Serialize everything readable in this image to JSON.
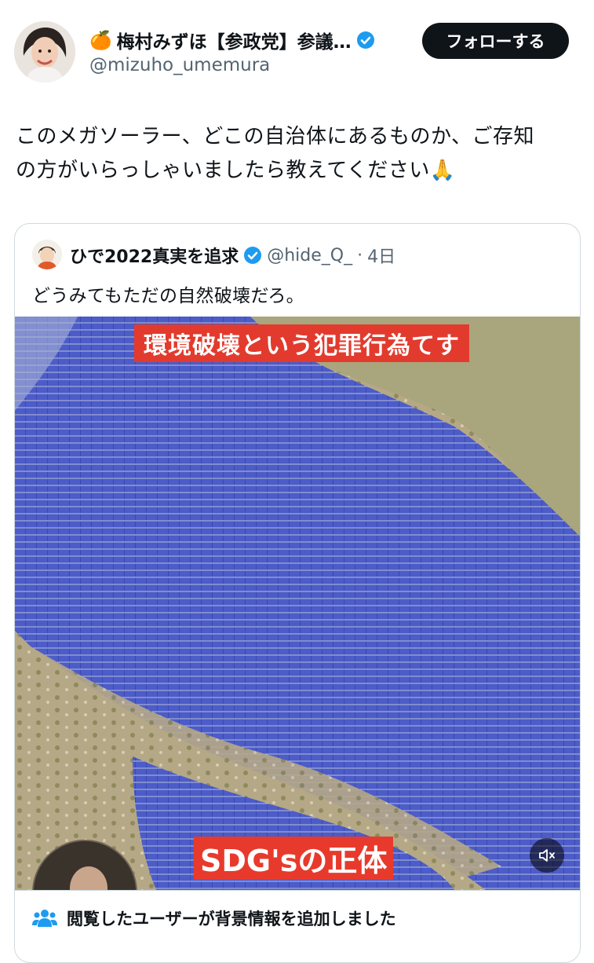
{
  "author": {
    "emoji": "🍊",
    "name": "梅村みずほ【参政党】参議…",
    "handle": "@mizuho_umemura"
  },
  "follow_label": "フォローする",
  "tweet_text_line1": "このメガソーラー、どこの自治体にあるものか、ご存知",
  "tweet_text_line2": "の方がいらっしゃいましたら教えてください🙏",
  "quote": {
    "name": "ひで2022真実を追求",
    "handle": "@hide_Q_",
    "dot": "·",
    "time": "4日",
    "text": "どうみてもただの自然破壊だろ。",
    "video_banner_top": "環境破壊という犯罪行為てす",
    "video_banner_bottom": "SDG'sの正体"
  },
  "community_note_label": "閲覧したユーザーが背景情報を追加しました",
  "colors": {
    "verified": "#1d9bf0",
    "follow_bg": "#0f1419",
    "banner_red": "#e23b2e",
    "handle_gray": "#536471"
  },
  "icons": [
    "verified-badge-icon",
    "mute-icon",
    "community-notes-icon"
  ]
}
